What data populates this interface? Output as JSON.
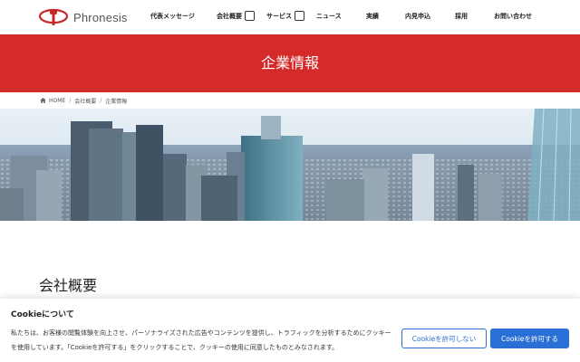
{
  "header": {
    "logo_text": "Phronesis",
    "nav": [
      {
        "label": "代表メッセージ",
        "dropdown": false
      },
      {
        "label": "会社概要",
        "dropdown": true
      },
      {
        "label": "サービス",
        "dropdown": true
      },
      {
        "label": "ニュース",
        "dropdown": false
      },
      {
        "label": "実績",
        "dropdown": false
      },
      {
        "label": "内見申込",
        "dropdown": false
      },
      {
        "label": "採用",
        "dropdown": false
      },
      {
        "label": "お問い合わせ",
        "dropdown": false
      }
    ]
  },
  "banner": {
    "title": "企業情報",
    "color": "#d42a2a"
  },
  "breadcrumb": {
    "home": "HOME",
    "level1": "会社概要",
    "level2": "企業情報"
  },
  "section": {
    "title": "会社概要"
  },
  "cookie": {
    "title": "Cookieについて",
    "text": "私たちは、お客様の閲覧体験を向上させ、パーソナライズされた広告やコンテンツを提供し、トラフィックを分析するためにクッキーを使用しています。「Cookieを許可する」をクリックすることで、クッキーの使用に同意したものとみなされます。",
    "reject_label": "Cookieを許可しない",
    "accept_label": "Cookieを許可する",
    "accent": "#2a6fd6"
  }
}
